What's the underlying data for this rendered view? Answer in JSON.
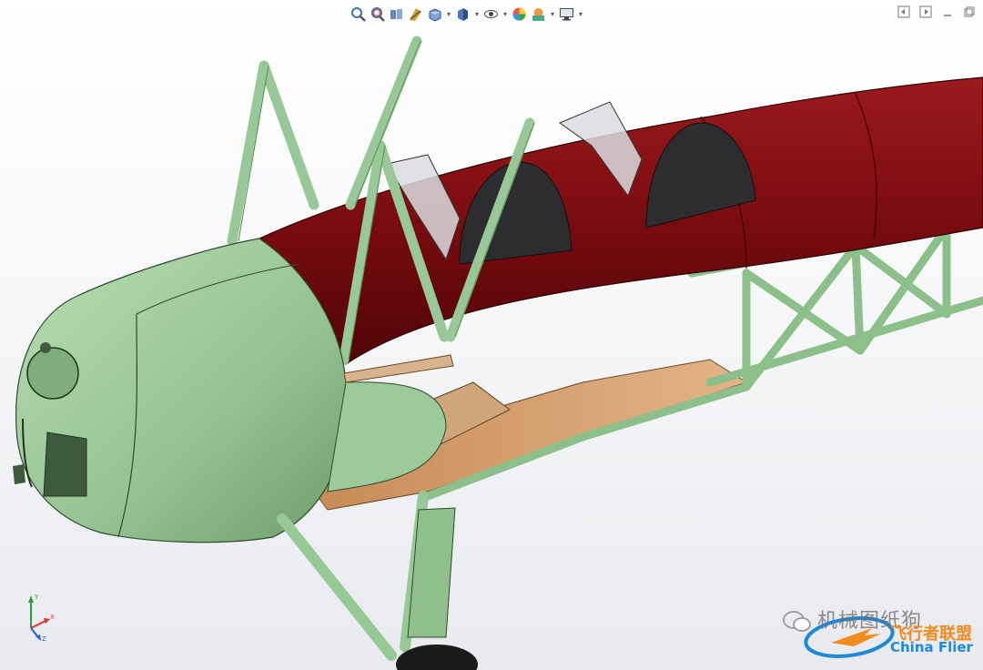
{
  "toolbar": {
    "tools": [
      {
        "name": "zoom-to-fit-icon"
      },
      {
        "name": "zoom-to-area-icon"
      },
      {
        "name": "previous-view-icon"
      },
      {
        "name": "section-view-icon"
      },
      {
        "name": "view-orientation-icon"
      },
      {
        "name": "display-style-icon"
      },
      {
        "name": "hide-show-items-icon"
      },
      {
        "name": "edit-appearance-icon"
      },
      {
        "name": "apply-scene-icon"
      },
      {
        "name": "view-settings-icon"
      }
    ]
  },
  "window_controls": [
    "tile-left-icon",
    "tile-right-icon",
    "minimize-icon",
    "restore-icon"
  ],
  "triad": {
    "x": "X",
    "y": "Y",
    "z": "Z"
  },
  "watermark": {
    "wechat_text": "机械图纸狗",
    "brand_cn": "飞行者联盟",
    "brand_en": "China Flier"
  },
  "colors": {
    "fuselage_covering": "#7a0c10",
    "frame_green": "#a9cfa5",
    "cowling_green": "#98c496",
    "floor_wood": "#d9a572",
    "glass": "#cfd3d6"
  }
}
